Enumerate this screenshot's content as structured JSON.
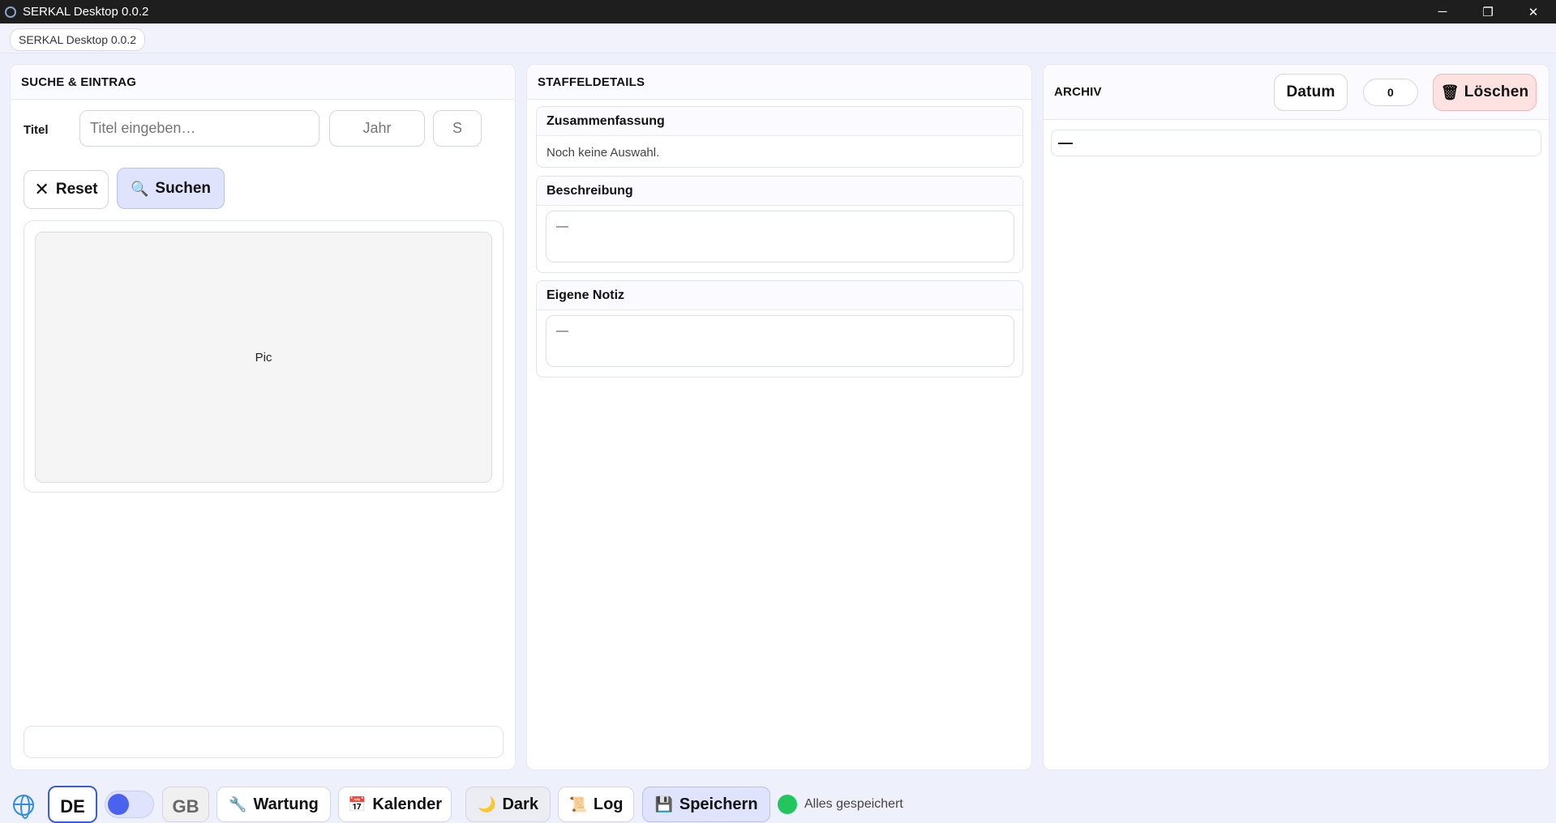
{
  "window": {
    "title": "SERKAL Desktop 0.0.2",
    "controls": {
      "minimize": "─",
      "maximize": "❐",
      "close": "✕"
    }
  },
  "tab": {
    "label": "SERKAL Desktop 0.0.2"
  },
  "left_panel": {
    "header": "SUCHE & EINTRAG",
    "title_label": "Titel",
    "title_placeholder": "Titel eingeben…",
    "year_placeholder": "Jahr",
    "season_placeholder": "S",
    "reset_label": "Reset",
    "reset_icon": "✕",
    "search_label": "Suchen",
    "search_icon": "🔍",
    "picture_label": "Pic"
  },
  "middle_panel": {
    "header": "STAFFELDETAILS",
    "summary": {
      "title": "Zusammenfassung",
      "text": "Noch keine Auswahl."
    },
    "description": {
      "title": "Beschreibung",
      "text": "—"
    },
    "note": {
      "title": "Eigene Notiz",
      "text": "—"
    }
  },
  "right_panel": {
    "header": "ARCHIV",
    "date_button": "Datum",
    "count": "0",
    "delete_label": "Löschen",
    "delete_icon": "🗑",
    "entry": "—"
  },
  "toolbar": {
    "lang_de": "DE",
    "lang_gb": "GB",
    "maintenance_label": "Wartung",
    "maintenance_icon": "🔧",
    "calendar_label": "Kalender",
    "calendar_icon": "📅",
    "dark_label": "Dark",
    "dark_icon": "🌙",
    "log_label": "Log",
    "log_icon": "📜",
    "save_label": "Speichern",
    "save_icon": "💾",
    "status_text": "Alles gespeichert",
    "status_color": "#22c55e"
  }
}
